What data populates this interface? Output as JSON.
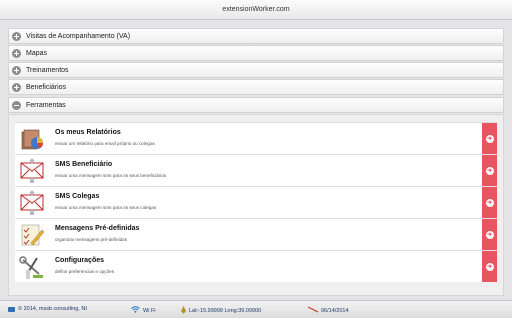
{
  "header": {
    "title": "extensionWorker.com"
  },
  "accordion": [
    {
      "label": "Visitas de Acompanhamento (VA)",
      "expanded": false,
      "icon": "plus-icon"
    },
    {
      "label": "Mapas",
      "expanded": false,
      "icon": "plus-icon"
    },
    {
      "label": "Treinamentos",
      "expanded": false,
      "icon": "plus-icon"
    },
    {
      "label": "Beneficiários",
      "expanded": false,
      "icon": "plus-icon"
    },
    {
      "label": "Ferramentas",
      "expanded": true,
      "icon": "minus-icon"
    }
  ],
  "tools": [
    {
      "title": "Os meus Relatórios",
      "desc": "enviar um relatório para email próprio ou colegas",
      "icon": "report-chart-icon"
    },
    {
      "title": "SMS Beneficiário",
      "desc": "enviar uma mensagem sms para os seus beneficiários",
      "icon": "envelope-person-icon"
    },
    {
      "title": "SMS Colegas",
      "desc": "enviar uma mensagem sms para os seus colegas",
      "icon": "envelope-person-icon"
    },
    {
      "title": "Mensagens Pré-definidas",
      "desc": "organizar mensagens pré-definidas",
      "icon": "checklist-pencil-icon"
    },
    {
      "title": "Configurações",
      "desc": "definir preferencias e opções",
      "icon": "tools-person-icon"
    }
  ],
  "footer": {
    "copyright": "© 2014, mssb consulting, NI",
    "wifi": "Wi Fi",
    "location": "Lat:-15.99999 Long:39.09900",
    "date": "06/14/2014"
  },
  "colors": {
    "accent": "#e8555e",
    "footer_text": "#1b3a6b",
    "background": "#e4e4e6"
  }
}
